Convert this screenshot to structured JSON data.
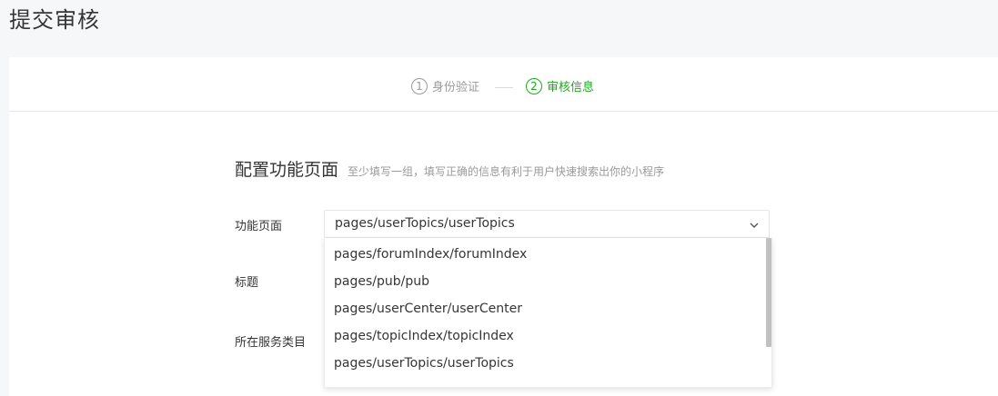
{
  "page": {
    "title": "提交审核"
  },
  "steps": [
    {
      "num": "1",
      "label": "身份验证",
      "state": "done"
    },
    {
      "num": "2",
      "label": "审核信息",
      "state": "active"
    }
  ],
  "section": {
    "title": "配置功能页面",
    "subtitle": "至少填写一组，填写正确的信息有利于用户快速搜索出你的小程序"
  },
  "form": {
    "page_label": "功能页面",
    "title_label": "标题",
    "category_label": "所在服务类目",
    "page_select": {
      "value": "pages/userTopics/userTopics",
      "options": [
        "pages/forumIndex/forumIndex",
        "pages/pub/pub",
        "pages/userCenter/userCenter",
        "pages/topicIndex/topicIndex",
        "pages/userTopics/userTopics"
      ]
    }
  },
  "colors": {
    "accent": "#1aad19",
    "muted": "#9a9a9a",
    "text": "#353535"
  },
  "icons": {
    "select_arrow": "chevron-down-icon"
  }
}
